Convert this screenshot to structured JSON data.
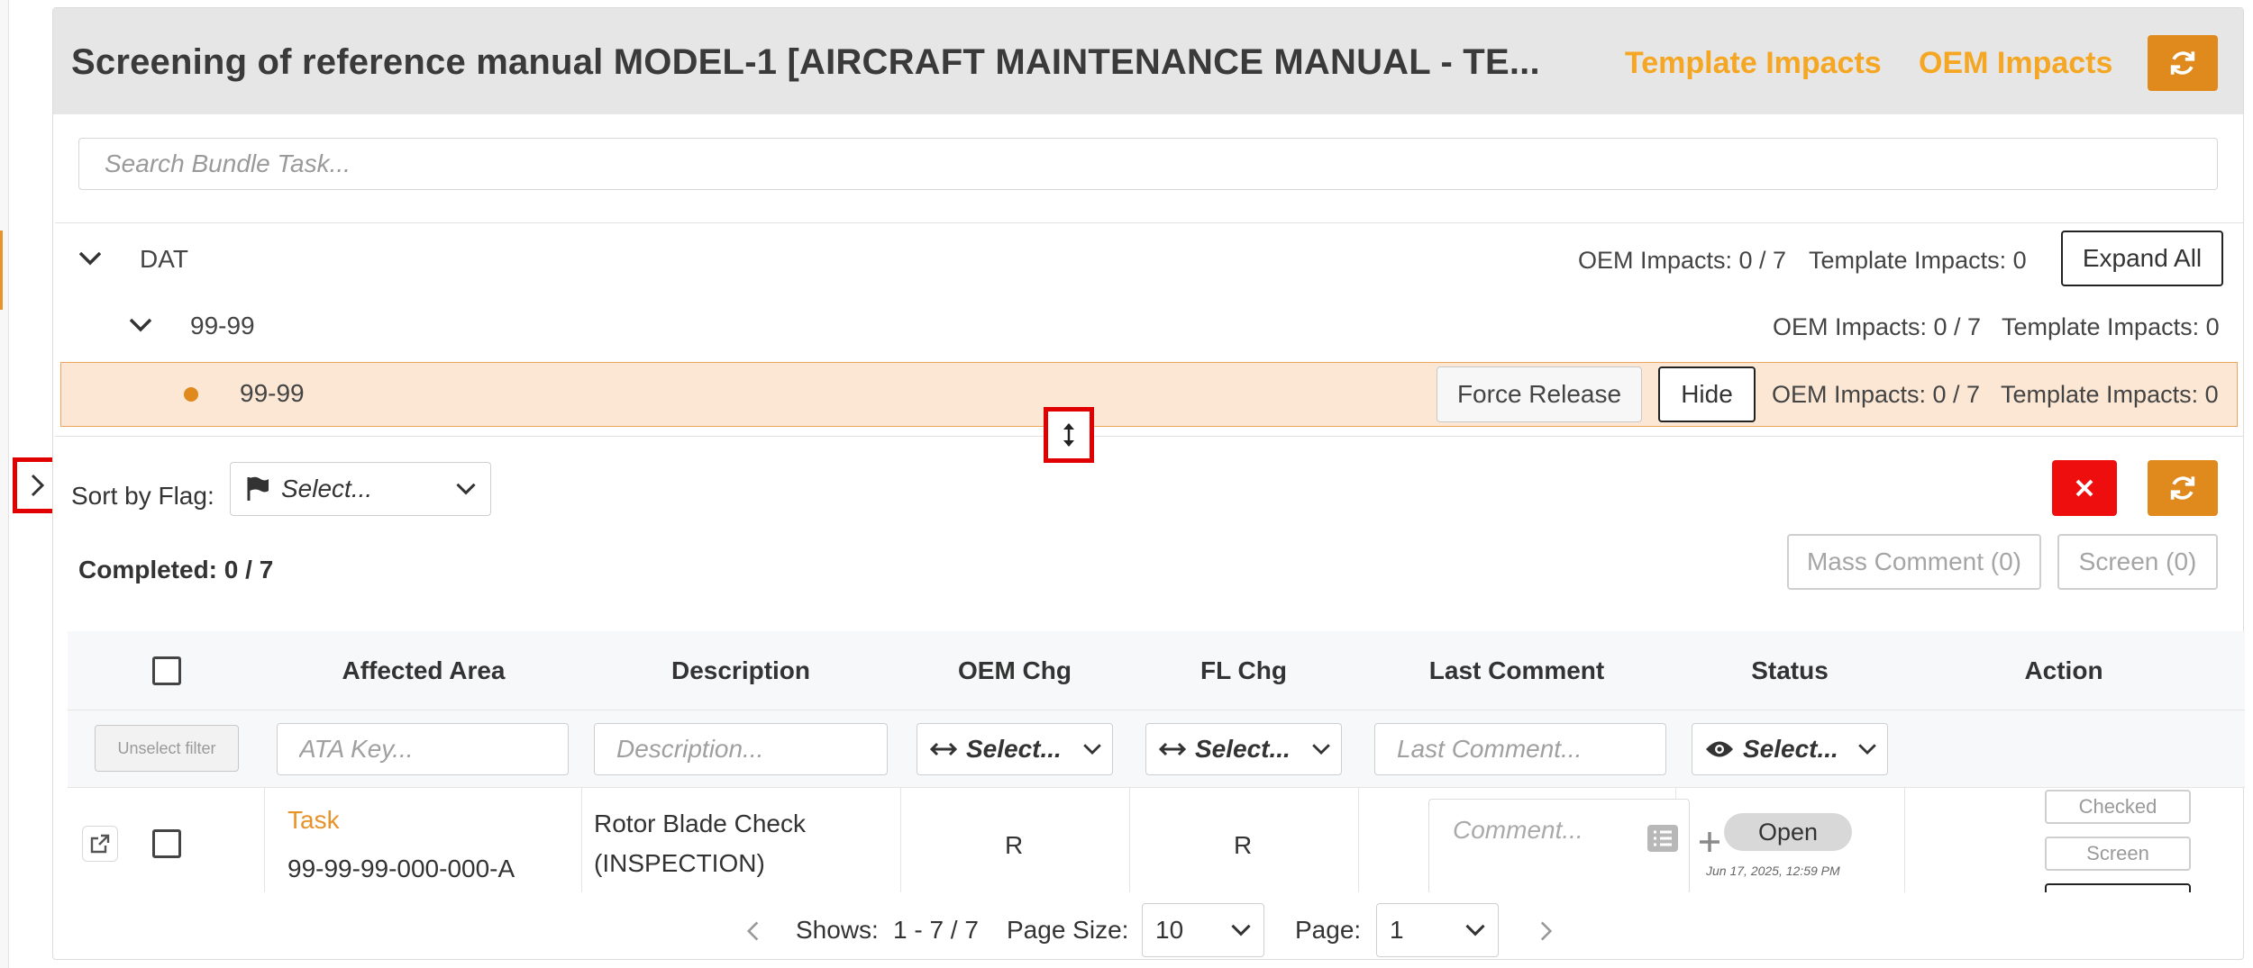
{
  "header": {
    "title": "Screening of reference manual MODEL-1 [AIRCRAFT MAINTENANCE MANUAL - TE...",
    "template_impacts_link": "Template Impacts",
    "oem_impacts_link": "OEM Impacts",
    "refresh_icon": "refresh-icon"
  },
  "search": {
    "placeholder": "Search Bundle Task..."
  },
  "tree": {
    "root": {
      "label": "DAT",
      "oem_impacts": "OEM Impacts: 0 / 7",
      "template_impacts": "Template Impacts: 0",
      "expand_all_label": "Expand All"
    },
    "child": {
      "label": "99-99",
      "oem_impacts": "OEM Impacts: 0 / 7",
      "template_impacts": "Template Impacts: 0"
    },
    "leaf": {
      "label": "99-99",
      "force_release_label": "Force Release",
      "hide_label": "Hide",
      "oem_impacts": "OEM Impacts: 0 / 7",
      "template_impacts": "Template Impacts: 0"
    }
  },
  "sort": {
    "label": "Sort by Flag:",
    "select_placeholder": "Select..."
  },
  "completed": "Completed: 0 / 7",
  "actions": {
    "mass_comment_label": "Mass Comment (0)",
    "screen_label": "Screen (0)"
  },
  "table": {
    "headers": [
      "Affected Area",
      "Description",
      "OEM Chg",
      "FL Chg",
      "Last Comment",
      "Status",
      "Action"
    ],
    "filters": {
      "unselect_label": "Unselect filter",
      "ata_placeholder": "ATA Key...",
      "description_placeholder": "Description...",
      "oem_select": "Select...",
      "fl_select": "Select...",
      "comment_placeholder": "Last Comment...",
      "status_select": "Select..."
    },
    "rows": [
      {
        "type_link": "Task",
        "ata_key": "99-99-99-000-000-A",
        "description_line1": "Rotor Blade Check",
        "description_line2": "(INSPECTION)",
        "oem_chg": "R",
        "fl_chg": "R",
        "comment_placeholder": "Comment...",
        "status": "Open",
        "status_date": "Jun 17, 2025, 12:59 PM",
        "action_checked": "Checked",
        "action_screen": "Screen"
      }
    ]
  },
  "pager": {
    "shows_label": "Shows:",
    "shows_value": "1 - 7 / 7",
    "page_size_label": "Page Size:",
    "page_size_value": "10",
    "page_label": "Page:",
    "page_value": "1"
  },
  "colors": {
    "accent": "#e08a1e",
    "link": "#f5a623",
    "danger": "#ee0e0e",
    "selected_row": "#fbe7d4"
  }
}
